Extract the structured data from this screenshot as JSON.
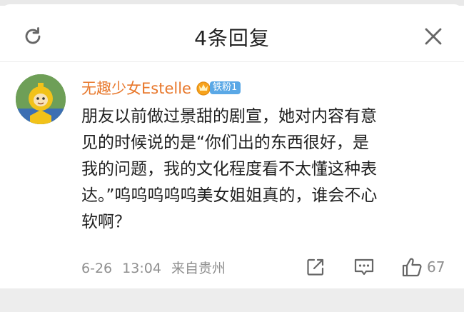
{
  "header": {
    "title": "4条回复",
    "refresh_icon": "refresh-icon",
    "close_icon": "close-icon"
  },
  "comment": {
    "username": "无趣少女Estelle",
    "badge_label": "铁粉1",
    "badge_icon": "crown-icon",
    "text": "朋友以前做过景甜的剧宣，她对内容有意\n见的时候说的是“你们出的东西很好，是\n我的问题，我的文化程度看不太懂这种表\n达。”呜呜呜呜呜美女姐姐真的，谁会不心\n软啊？",
    "date": "6-26",
    "time": "13:04",
    "location": "来自贵州",
    "like_count": "67"
  },
  "colors": {
    "username": "#e8782c",
    "badge": "#5aa8e6",
    "meta": "#8f8f8f"
  }
}
